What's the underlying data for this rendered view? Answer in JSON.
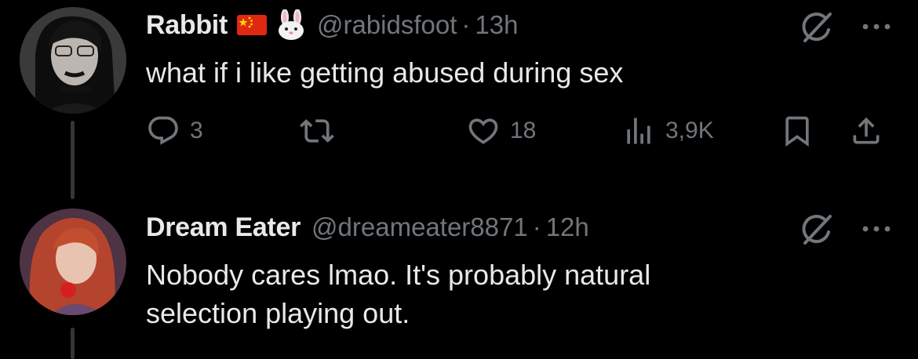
{
  "tweets": [
    {
      "display_name": "Rabbit",
      "handle": "@rabidsfoot",
      "separator": "·",
      "time": "13h",
      "text": "what if i like getting abused during sex",
      "stats": {
        "replies": "3",
        "likes": "18",
        "views": "3,9K"
      },
      "badges": [
        "china-flag-emoji",
        "rabbit-face-emoji"
      ]
    },
    {
      "display_name": "Dream Eater",
      "handle": "@dreameater8871",
      "separator": "·",
      "time": "12h",
      "text_lines": [
        "Nobody cares lmao. It's probably natural",
        "selection playing out."
      ]
    }
  ],
  "colors": {
    "background": "#000000",
    "text": "#e7e9ea",
    "muted": "#71767b",
    "thread_line": "#333639"
  }
}
